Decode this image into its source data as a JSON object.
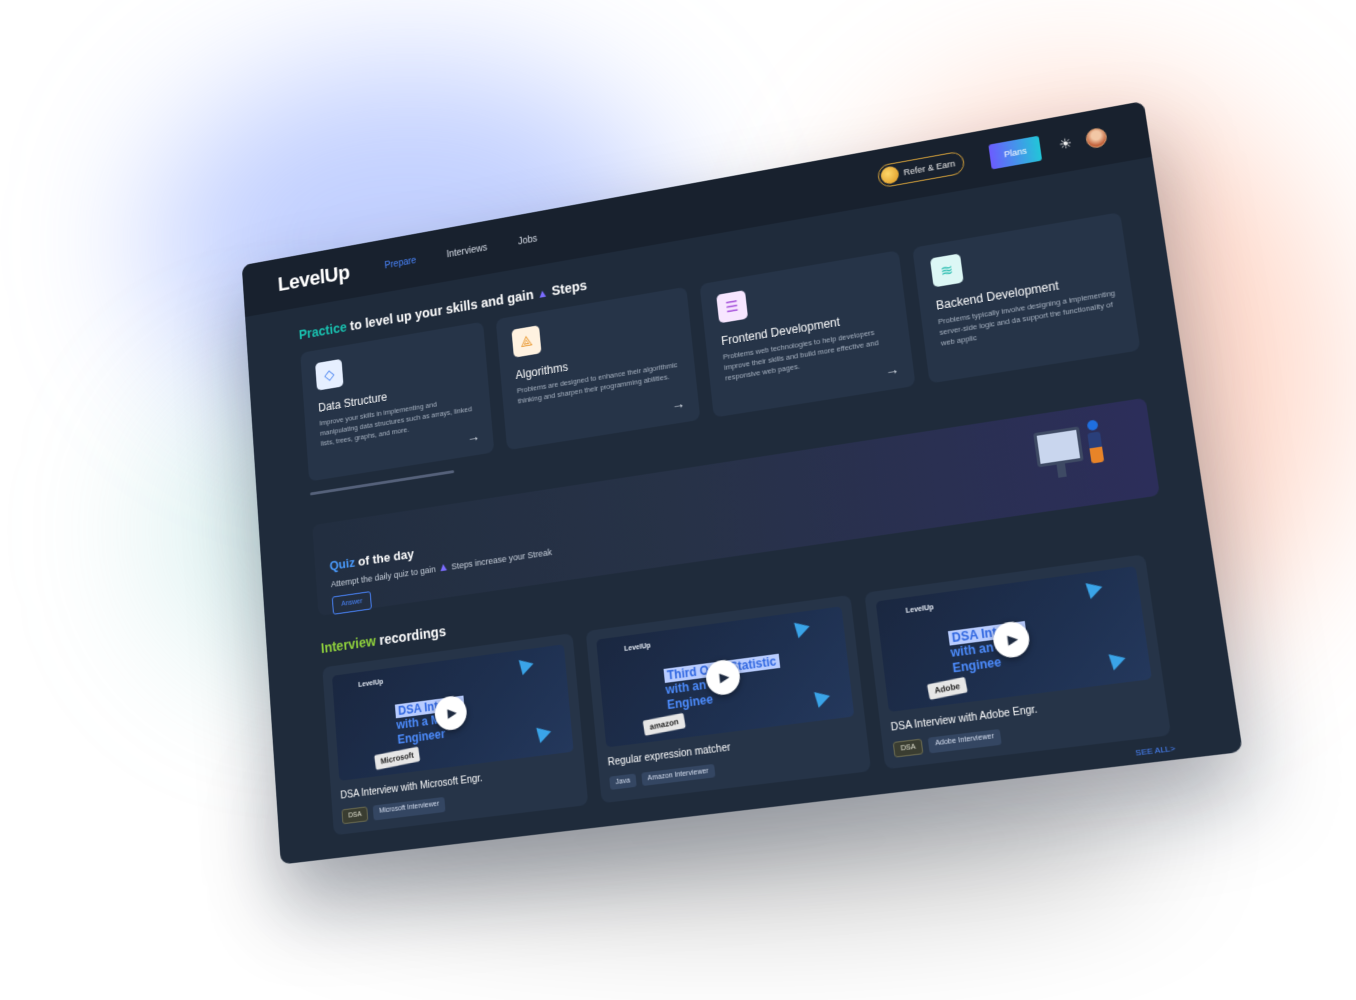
{
  "app": {
    "logo": "LevelUp"
  },
  "nav": {
    "items": [
      {
        "label": "Prepare",
        "active": true
      },
      {
        "label": "Interviews",
        "active": false
      },
      {
        "label": "Jobs",
        "active": false
      }
    ],
    "refer_label": "Refer & Earn",
    "plans_label": "Plans",
    "theme_icon": "sun-icon"
  },
  "practice": {
    "title_highlight": "Practice",
    "title_rest": " to level up your skills and gain ",
    "title_end": "Steps",
    "cards": [
      {
        "icon": "cube-icon",
        "title": "Data Structure",
        "desc": "Improve your skills in implementing and manipulating data structures such as arrays, linked lists, trees, graphs, and more."
      },
      {
        "icon": "algorithm-icon",
        "title": "Algorithms",
        "desc": "Problems are designed to enhance their algorithmic thinking and sharpen their programming abilities."
      },
      {
        "icon": "list-icon",
        "title": "Frontend Development",
        "desc": "Problems web technologies to help developers improve their skills and build more effective and responsive web pages."
      },
      {
        "icon": "database-icon",
        "title": "Backend Development",
        "desc": "Problems typically involve designing a implementing server-side logic and da support the functionality of web applic"
      }
    ]
  },
  "quiz": {
    "title_highlight": "Quiz",
    "title_rest": " of the day",
    "sub_start": "Attempt the daily quiz to gain ",
    "sub_end": "Steps increase your Streak",
    "button": "Answer"
  },
  "recordings": {
    "title_highlight": "Interview",
    "title_rest": " recordings",
    "items": [
      {
        "thumb_logo": "LevelUp",
        "thumb_line1": "DSA Inte",
        "thumb_line1b": "w",
        "thumb_line2": "with a M",
        "thumb_line2b": "ft",
        "thumb_line3": "Engineer",
        "brand": "Microsoft",
        "name": "DSA Interview with Microsoft Engr.",
        "tags": [
          "DSA",
          "Microsoft Interviewer"
        ]
      },
      {
        "thumb_logo": "LevelUp",
        "thumb_line1": "Third Ord",
        "thumb_line1b": "Statistic",
        "thumb_line2": "with an",
        "thumb_line2b": "n",
        "thumb_line3": "Enginee",
        "brand": "amazon",
        "name": "Regular expression matcher",
        "tags": [
          "Java",
          "Amazon Interviewer"
        ]
      },
      {
        "thumb_logo": "LevelUp",
        "thumb_line1": "DSA Inte",
        "thumb_line1b": "w",
        "thumb_line2": "with an",
        "thumb_line2b": "",
        "thumb_line3": "Enginee",
        "brand": "Adobe",
        "name": "DSA Interview with Adobe Engr.",
        "tags": [
          "DSA",
          "Adobe Interviewer"
        ]
      }
    ],
    "see_all": "SEE ALL>"
  }
}
